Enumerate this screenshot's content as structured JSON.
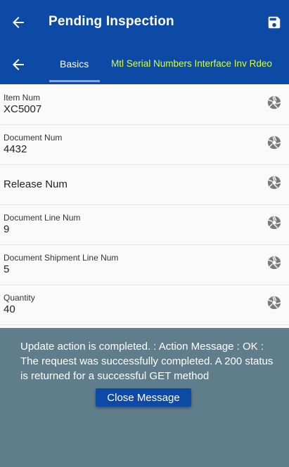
{
  "header": {
    "title": "Pending Inspection",
    "back_icon": "arrow-left-icon",
    "save_icon": "save-icon",
    "bg_color": "#0d4aa5"
  },
  "tabs": {
    "back_icon": "arrow-left-icon",
    "items": [
      {
        "label": "Basics",
        "active": true
      },
      {
        "label": "Mtl Serial Numbers Interface Inv Rdeo",
        "active": false,
        "color": "#d6ff3f"
      }
    ]
  },
  "fields": [
    {
      "label": "Item Num",
      "value": "XC5007"
    },
    {
      "label": "Document Num",
      "value": "4432"
    },
    {
      "label": "Release Num",
      "value": ""
    },
    {
      "label": "Document Line Num",
      "value": "9"
    },
    {
      "label": "Document Shipment Line Num",
      "value": "5"
    },
    {
      "label": "Quantity",
      "value": "40"
    }
  ],
  "message": {
    "text": "Update action is completed.  : Action Message : OK : The request was successfully completed. A 200 status is returned for a successful GET method",
    "close_label": "Close Message",
    "bg_color": "#607d8b"
  }
}
